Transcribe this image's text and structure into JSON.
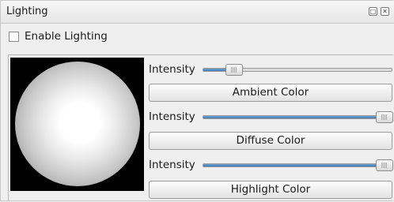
{
  "panel": {
    "title": "Lighting",
    "float_icon": "restore-window-icon",
    "close_icon": "close-icon"
  },
  "enable_lighting": {
    "label": "Enable Lighting",
    "checked": false
  },
  "controls": [
    {
      "intensity_label": "Intensity",
      "intensity_fraction": 0.13,
      "button_label": "Ambient Color"
    },
    {
      "intensity_label": "Intensity",
      "intensity_fraction": 1.0,
      "button_label": "Diffuse Color"
    },
    {
      "intensity_label": "Intensity",
      "intensity_fraction": 1.0,
      "button_label": "Highlight Color"
    }
  ],
  "colors": {
    "slider_fill": "#4f88c2",
    "preview_background": "#000000",
    "sphere_highlight": "#ffffff"
  }
}
